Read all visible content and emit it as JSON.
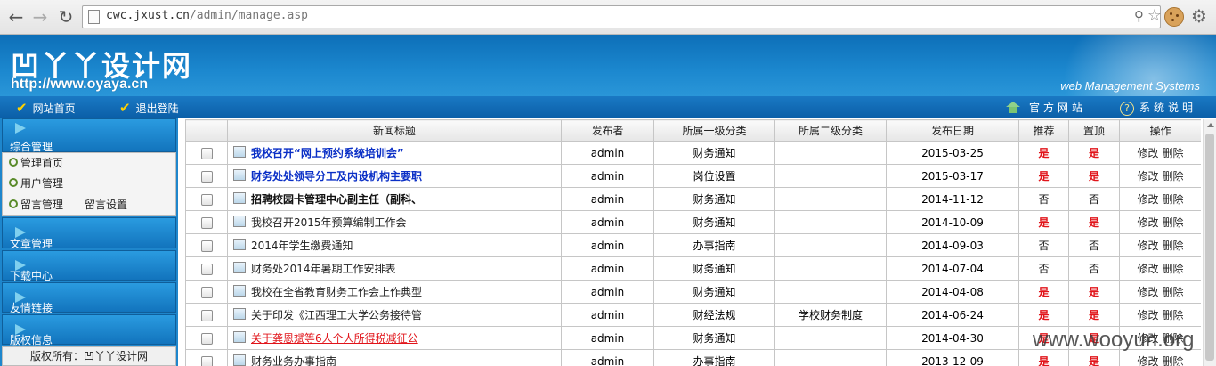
{
  "browser": {
    "url_host": "cwc.jxust.cn",
    "url_path": "/admin/manage.asp"
  },
  "banner": {
    "logo_text": "凹丫丫设计网",
    "logo_url": "http://www.oyaya.cn",
    "system_name": "web Management Systems"
  },
  "topnav": {
    "home_label": "网站首页",
    "logout_label": "退出登陆",
    "official_site_label": "官方网站",
    "system_help_label": "系统说明"
  },
  "sidebar": {
    "sections": [
      {
        "label": "综合管理"
      },
      {
        "label": "文章管理"
      },
      {
        "label": "下载中心"
      },
      {
        "label": "友情链接"
      },
      {
        "label": "版权信息"
      }
    ],
    "submenu": [
      {
        "label": "管理首页"
      },
      {
        "label": "用户管理"
      },
      {
        "label": "留言管理"
      }
    ],
    "submenu_extra": "留言设置",
    "copyright": "版权所有：凹丫丫设计网"
  },
  "table": {
    "headers": [
      "",
      "新闻标题",
      "发布者",
      "所属一级分类",
      "所属二级分类",
      "发布日期",
      "推荐",
      "置顶",
      "操作"
    ],
    "rows": [
      {
        "title": "我校召开“网上预约系统培训会”",
        "style": "blue",
        "author": "admin",
        "cat1": "财务通知",
        "cat2": "",
        "date": "2015-03-25",
        "recommend": "是",
        "top": "是"
      },
      {
        "title": "财务处处领导分工及内设机构主要职",
        "style": "blue",
        "author": "admin",
        "cat1": "岗位设置",
        "cat2": "",
        "date": "2015-03-17",
        "recommend": "是",
        "top": "是"
      },
      {
        "title": "招聘校园卡管理中心副主任（副科、",
        "style": "bold",
        "author": "admin",
        "cat1": "财务通知",
        "cat2": "",
        "date": "2014-11-12",
        "recommend": "否",
        "top": "否"
      },
      {
        "title": "我校召开2015年预算编制工作会",
        "style": "normal",
        "author": "admin",
        "cat1": "财务通知",
        "cat2": "",
        "date": "2014-10-09",
        "recommend": "是",
        "top": "是"
      },
      {
        "title": "2014年学生缴费通知",
        "style": "normal",
        "author": "admin",
        "cat1": "办事指南",
        "cat2": "",
        "date": "2014-09-03",
        "recommend": "否",
        "top": "否"
      },
      {
        "title": "财务处2014年暑期工作安排表",
        "style": "normal",
        "author": "admin",
        "cat1": "财务通知",
        "cat2": "",
        "date": "2014-07-04",
        "recommend": "否",
        "top": "否"
      },
      {
        "title": "我校在全省教育财务工作会上作典型",
        "style": "normal",
        "author": "admin",
        "cat1": "财务通知",
        "cat2": "",
        "date": "2014-04-08",
        "recommend": "是",
        "top": "是"
      },
      {
        "title": "关于印发《江西理工大学公务接待管",
        "style": "normal",
        "author": "admin",
        "cat1": "财经法规",
        "cat2": "学校财务制度",
        "date": "2014-06-24",
        "recommend": "是",
        "top": "是"
      },
      {
        "title": "关于龚恩斌等6人个人所得税减征公",
        "style": "red",
        "author": "admin",
        "cat1": "财务通知",
        "cat2": "",
        "date": "2014-04-30",
        "recommend": "是",
        "top": "是"
      },
      {
        "title": "财务业务办事指南",
        "style": "normal",
        "author": "admin",
        "cat1": "办事指南",
        "cat2": "",
        "date": "2013-12-09",
        "recommend": "是",
        "top": "是"
      }
    ],
    "edit_label": "修改",
    "delete_label": "删除"
  },
  "watermark": "www.wooyun.org",
  "colors": {
    "banner_blue": "#1c88cf",
    "highlight_red": "#e1141a",
    "title_blue": "#0a2fc6"
  }
}
